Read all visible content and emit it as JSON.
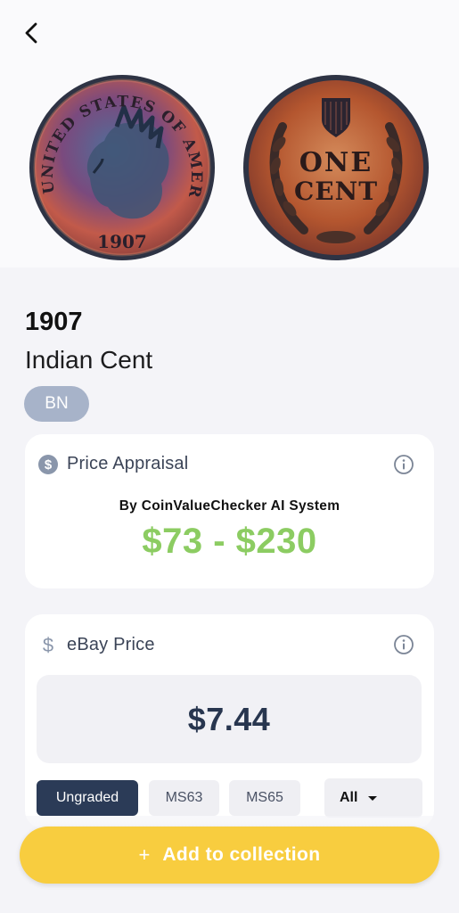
{
  "coin": {
    "year": "1907",
    "name": "Indian Cent",
    "grade": "BN",
    "obverse_legend": "UNITED STATES OF AMERICA",
    "obverse_date": "1907",
    "reverse_text_line1": "ONE",
    "reverse_text_line2": "CENT"
  },
  "appraisal": {
    "title": "Price Appraisal",
    "by_line": "By CoinValueChecker AI System",
    "price_range": "$73 - $230",
    "icon": "dollar-circle-icon"
  },
  "ebay": {
    "title": "eBay Price",
    "value": "$7.44",
    "icon": "dollar-icon",
    "filters": [
      "Ungraded",
      "MS63",
      "MS65"
    ],
    "selected_filter": "Ungraded",
    "dropdown_value": "All"
  },
  "actions": {
    "add_label": "Add to collection",
    "add_icon": "+"
  },
  "colors": {
    "accent_green": "#8ccc62",
    "cta_yellow": "#f8cd3f",
    "navy": "#2b3b57",
    "badge_gray": "#a7b3c9"
  }
}
